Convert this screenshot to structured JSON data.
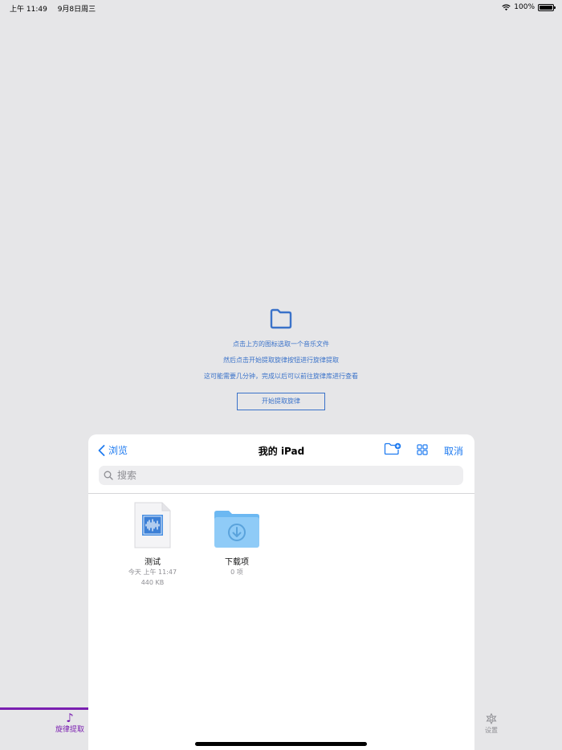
{
  "status_bar": {
    "time": "上午 11:49",
    "date": "9月8日周三",
    "battery": "100%",
    "battery_level": 1.0
  },
  "main": {
    "instruction_1": "点击上方的图标选取一个音乐文件",
    "instruction_2": "然后点击开始提取旋律按钮进行旋律提取",
    "instruction_3": "这可能需要几分钟，完成以后可以前往旋律库进行查看",
    "start_button": "开始提取旋律",
    "icon": "folder-icon",
    "accent_color": "#3a72c9"
  },
  "tab_bar": {
    "melody_tab": "旋律提取",
    "settings_tab": "设置",
    "active_color": "#7a1fb0"
  },
  "picker": {
    "back_label": "浏览",
    "title": "我的 iPad",
    "cancel_label": "取消",
    "search_placeholder": "搜索",
    "accent_color": "#1f7bf0",
    "files": [
      {
        "name": "测试",
        "date": "今天 上午 11:47",
        "size": "440 KB",
        "icon": "audio-file-icon"
      },
      {
        "name": "下载项",
        "count": "0 项",
        "icon": "download-folder-icon"
      }
    ]
  }
}
